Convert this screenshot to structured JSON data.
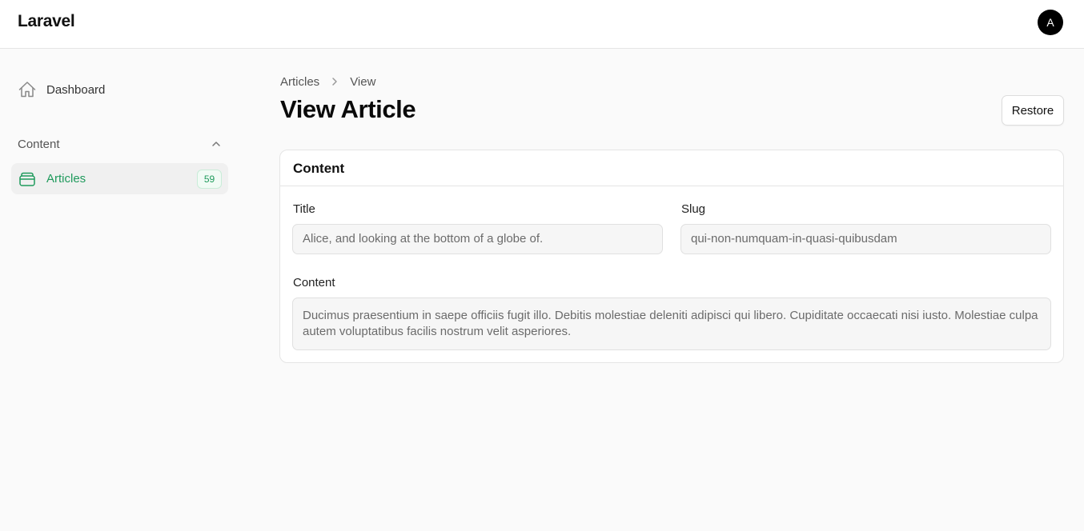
{
  "header": {
    "brand": "Laravel",
    "avatar_initial": "A"
  },
  "sidebar": {
    "dashboard": {
      "label": "Dashboard",
      "icon": "home-icon"
    },
    "group": {
      "label": "Content",
      "icon": "chevron-up-icon"
    },
    "articles": {
      "label": "Articles",
      "icon": "archive-box-icon",
      "count": "59"
    }
  },
  "breadcrumb": {
    "items": [
      "Articles",
      "View"
    ]
  },
  "page": {
    "title": "View Article",
    "restore_label": "Restore"
  },
  "card": {
    "title": "Content",
    "fields": {
      "title": {
        "label": "Title",
        "value": "Alice, and looking at the bottom of a globe of."
      },
      "slug": {
        "label": "Slug",
        "value": "qui-non-numquam-in-quasi-quibusdam"
      },
      "content": {
        "label": "Content",
        "value": "Ducimus praesentium in saepe officiis fugit illo. Debitis molestiae deleniti adipisci qui libero. Cupiditate occaecati nisi iusto. Molestiae culpa autem voluptatibus facilis nostrum velit asperiores."
      }
    }
  },
  "colors": {
    "accent": "#1f9a5c",
    "background": "#fafafa",
    "surface": "#ffffff",
    "border": "#e5e5e5"
  }
}
